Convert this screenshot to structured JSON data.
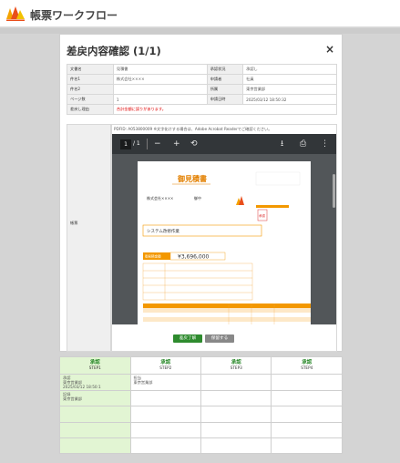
{
  "app": {
    "title": "帳票ワークフロー"
  },
  "modal": {
    "title": "差戻内容確認 (1/1)",
    "close_label": "×",
    "info_rows": [
      {
        "l1": "文書名",
        "v1": "見積書",
        "l2": "承認状況",
        "v2": "承認し"
      },
      {
        "l1": "件名1",
        "v1": "株式会社××××",
        "l2": "申請者",
        "v2": "社員"
      },
      {
        "l1": "件名2",
        "v1": "",
        "l2": "所属",
        "v2": "東京営業部"
      },
      {
        "l1": "ページ数",
        "v1": "1",
        "l2": "申請日時",
        "v2": "2025/03/12 18:50:32"
      }
    ],
    "reason": {
      "label": "差戻し理由",
      "value": "合計金額に誤りがあります。"
    },
    "document": {
      "label": "帳票",
      "note": "PDFID: A053800009  ※文字化けする場合は、Adobe Acrobat Readerでご確認ください。"
    },
    "pdf": {
      "page": "1",
      "total": "/ 1",
      "icons": [
        "menu-icon",
        "zoom-out-icon",
        "zoom-in-icon",
        "rotate-icon",
        "download-icon",
        "print-icon",
        "more-icon"
      ],
      "doc_title": "御見積書",
      "company": "株式会社××××",
      "honorific": "御中",
      "section": "システム改修作業",
      "amount_label": "御見積金額",
      "amount": "¥3,696,000",
      "stamp": "承認"
    },
    "approve_label": "差戻了解",
    "reject_label": "保留する"
  },
  "steps": {
    "headers": [
      {
        "t1": "承認",
        "t2": "STEP1"
      },
      {
        "t1": "承認",
        "t2": "STEP2"
      },
      {
        "t1": "承認",
        "t2": "STEP3"
      },
      {
        "t1": "承認",
        "t2": "STEP4"
      }
    ],
    "rows": [
      [
        "承認\n東京営業部\n2025/03/12 18:50:1",
        "担当\n東京営業部",
        "",
        ""
      ],
      [
        "記録\n東京営業部",
        "",
        "",
        ""
      ],
      [
        "",
        "",
        "",
        ""
      ],
      [
        "",
        "",
        "",
        ""
      ],
      [
        "",
        "",
        "",
        ""
      ]
    ]
  },
  "colors": {
    "accent_green": "#2e8b2e",
    "pdf_orange": "#f39800",
    "reason_red": "#e00000"
  }
}
